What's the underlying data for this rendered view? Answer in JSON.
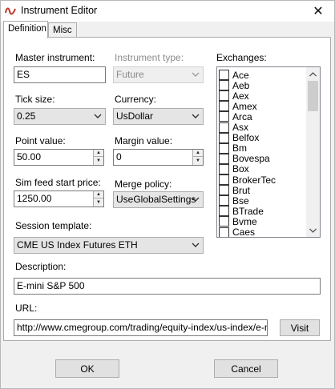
{
  "window": {
    "title": "Instrument Editor",
    "close_glyph": "✕"
  },
  "tabs": [
    {
      "label": "Definition",
      "active": true
    },
    {
      "label": "Misc",
      "active": false
    }
  ],
  "form": {
    "master_instrument": {
      "label": "Master instrument:",
      "value": "ES"
    },
    "instrument_type": {
      "label": "Instrument type:",
      "value": "Future",
      "disabled": true
    },
    "tick_size": {
      "label": "Tick size:",
      "value": "0.25"
    },
    "currency": {
      "label": "Currency:",
      "value": "UsDollar"
    },
    "point_value": {
      "label": "Point value:",
      "value": "50.00"
    },
    "margin_value": {
      "label": "Margin value:",
      "value": "0"
    },
    "sim_feed_start_price": {
      "label": "Sim feed start price:",
      "value": "1250.00"
    },
    "merge_policy": {
      "label": "Merge policy:",
      "value": "UseGlobalSettings"
    },
    "session_template": {
      "label": "Session template:",
      "value": "CME US Index Futures ETH"
    },
    "description": {
      "label": "Description:",
      "value": "E-mini S&P 500"
    },
    "url": {
      "label": "URL:",
      "value": "http://www.cmegroup.com/trading/equity-index/us-index/e-mini-s"
    },
    "visit_label": "Visit"
  },
  "exchanges": {
    "label": "Exchanges:",
    "items": [
      "Ace",
      "Aeb",
      "Aex",
      "Amex",
      "Arca",
      "Asx",
      "Belfox",
      "Bm",
      "Bovespa",
      "Box",
      "BrokerTec",
      "Brut",
      "Bse",
      "BTrade",
      "Bvme",
      "Caes"
    ]
  },
  "footer": {
    "ok_label": "OK",
    "cancel_label": "Cancel"
  },
  "colors": {
    "window_bg": "#f0f0f0",
    "panel_bg": "#ffffff",
    "button_bg": "#e1e1e1",
    "icon_red": "#c0392b"
  }
}
